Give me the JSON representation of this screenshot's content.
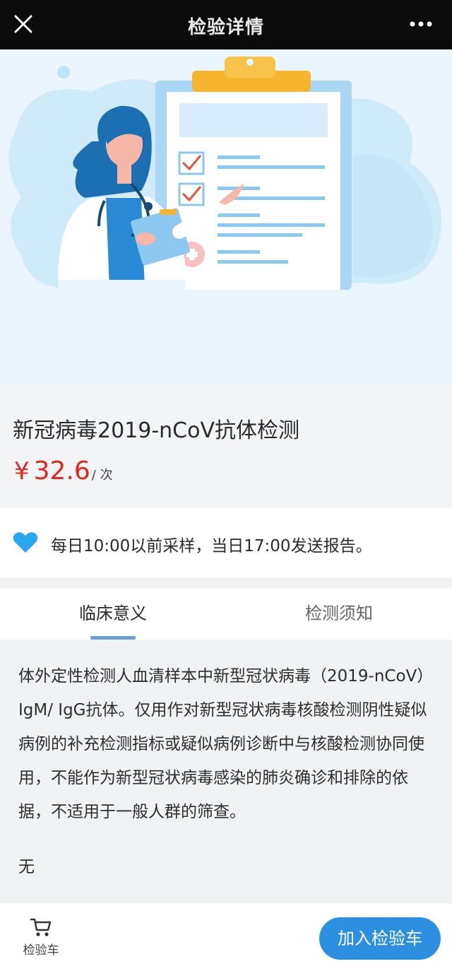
{
  "header": {
    "title": "检验详情",
    "close_icon": "close-icon",
    "more_icon": "more-dots-icon"
  },
  "product": {
    "name": "新冠病毒2019-nCoV抗体检测",
    "currency": "¥",
    "price": "32.6",
    "unit": "/ 次"
  },
  "notice": {
    "icon": "heart-icon",
    "text": "每日10:00以前采样，当日17:00发送报告。"
  },
  "tabs": [
    {
      "label": "临床意义",
      "active": true
    },
    {
      "label": "检测须知",
      "active": false
    }
  ],
  "content": {
    "paragraph": "体外定性检测人血清样本中新型冠状病毒（2019-nCoV）IgM/ IgG抗体。仅用作对新型冠状病毒核酸检测阴性疑似病例的补充检测指标或疑似病例诊断中与核酸检测协同使用，不能作为新型冠状病毒感染的肺炎确诊和排除的依据，不适用于一般人群的筛查。",
    "note": "无"
  },
  "bottom": {
    "cart_label": "检验车",
    "cart_icon": "cart-icon",
    "add_button": "加入检验车"
  },
  "colors": {
    "price": "#e0261d",
    "accent": "#2d8fe0",
    "heart": "#29a6f0",
    "tab_underline": "#6e9dd0"
  }
}
